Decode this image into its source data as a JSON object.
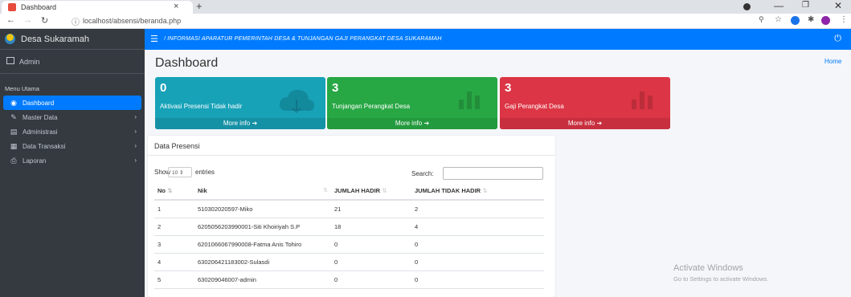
{
  "browser": {
    "tab_title": "Dashboard",
    "tab_close": "×",
    "new_tab": "+",
    "url": "localhost/absensi/beranda.php"
  },
  "brand": {
    "name": "Desa Sukaramah"
  },
  "user": {
    "name": "Admin"
  },
  "sidebar": {
    "header": "Menu Utama",
    "items": [
      {
        "label": "Dashboard",
        "icon": "dashboard-icon",
        "active": true
      },
      {
        "label": "Master Data",
        "icon": "edit-icon"
      },
      {
        "label": "Administrasi",
        "icon": "list-icon"
      },
      {
        "label": "Data Transaksi",
        "icon": "table-icon"
      },
      {
        "label": "Laporan",
        "icon": "print-icon"
      }
    ]
  },
  "topnav": {
    "marquee": "! INFORMASI APARATUR PEMERINTAH DESA & TUNJANGAN GAJI PERANGKAT DESA SUKARAMAH"
  },
  "page": {
    "title": "Dashboard",
    "breadcrumb": "Home"
  },
  "boxes": [
    {
      "value": "0",
      "label": "Aktivasi Presensi Tidak hadir",
      "footer": "More info",
      "color": "#17a2b8"
    },
    {
      "value": "3",
      "label": "Tunjangan Perangkat Desa",
      "footer": "More info",
      "color": "#28a745"
    },
    {
      "value": "3",
      "label": "Gaji Perangkat Desa",
      "footer": "More info",
      "color": "#dc3545"
    }
  ],
  "table": {
    "title": "Data Presensi",
    "show_label": "Show",
    "page_size": "10",
    "entries_label": "entries",
    "search_label": "Search:",
    "headers": [
      "No",
      "Nik",
      "JUMLAH HADIR",
      "JUMLAH TIDAK HADIR"
    ],
    "rows": [
      [
        "1",
        "510302020597-Miko",
        "21",
        "2"
      ],
      [
        "2",
        "6205056203990001-Siti Khoiriyah S.P",
        "18",
        "4"
      ],
      [
        "3",
        "6201066067990008-Fatma Anis Tohiro",
        "0",
        "0"
      ],
      [
        "4",
        "630206421183002-Sulasdi",
        "0",
        "0"
      ],
      [
        "5",
        "630209046007-admin",
        "0",
        "0"
      ]
    ]
  },
  "watermark": {
    "line1": "Activate Windows",
    "line2": "Go to Settings to activate Windows."
  }
}
